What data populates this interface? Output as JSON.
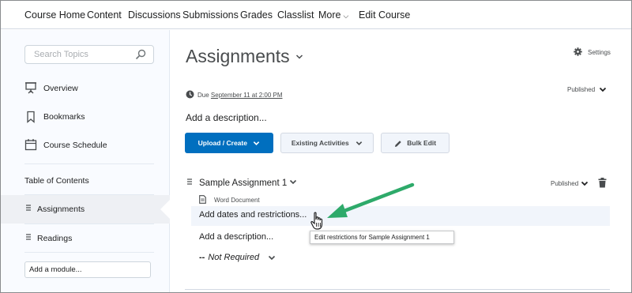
{
  "nav": {
    "items": [
      "Course Home",
      "Content",
      "Discussions",
      "Submissions",
      "Grades",
      "Classlist",
      "More",
      "Edit Course"
    ]
  },
  "sidebar": {
    "search_placeholder": "Search Topics",
    "items": [
      {
        "label": "Overview",
        "icon": "presentation-icon"
      },
      {
        "label": "Bookmarks",
        "icon": "bookmark-icon"
      },
      {
        "label": "Course Schedule",
        "icon": "calendar-icon"
      }
    ],
    "toc_heading": "Table of Contents",
    "modules": [
      "Assignments",
      "Readings"
    ],
    "add_module_placeholder": "Add a module..."
  },
  "main": {
    "title": "Assignments",
    "settings_label": "Settings",
    "due_prefix": "Due",
    "due_date": "September 11 at 2:00 PM",
    "published_label": "Published",
    "add_description": "Add a description...",
    "buttons": {
      "upload_create": "Upload / Create",
      "existing_activities": "Existing Activities",
      "bulk_edit": "Bulk Edit"
    },
    "item": {
      "title": "Sample Assignment 1",
      "published_label": "Published",
      "doc_type": "Word Document",
      "restrictions_link": "Add dates and restrictions...",
      "description_link": "Add a description...",
      "completion_dash": "--",
      "completion": "Not Required",
      "tooltip": "Edit restrictions for Sample Assignment 1"
    }
  },
  "colors": {
    "primary_button": "#006fbf",
    "annotation_arrow": "#2eaa6a",
    "active_row": "#f1f5fb"
  }
}
